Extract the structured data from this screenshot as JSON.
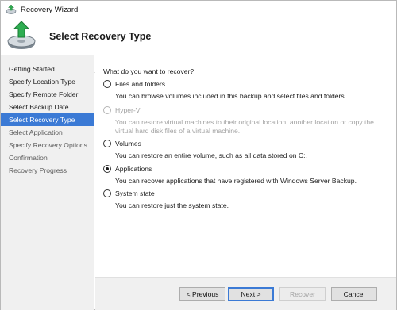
{
  "window": {
    "title": "Recovery Wizard"
  },
  "header": {
    "title": "Select Recovery Type"
  },
  "sidebar": {
    "steps": [
      {
        "label": "Getting Started",
        "state": "done"
      },
      {
        "label": "Specify Location Type",
        "state": "done"
      },
      {
        "label": "Specify Remote Folder",
        "state": "done"
      },
      {
        "label": "Select Backup Date",
        "state": "done"
      },
      {
        "label": "Select Recovery Type",
        "state": "active"
      },
      {
        "label": "Select Application",
        "state": "future"
      },
      {
        "label": "Specify Recovery Options",
        "state": "future"
      },
      {
        "label": "Confirmation",
        "state": "future"
      },
      {
        "label": "Recovery Progress",
        "state": "future"
      }
    ]
  },
  "main": {
    "question": "What do you want to recover?",
    "options": [
      {
        "label": "Files and folders",
        "description": "You can browse volumes included in this backup and select files and folders.",
        "checked": false,
        "enabled": true
      },
      {
        "label": "Hyper-V",
        "description": "You can restore virtual machines to their original location, another location or copy the virtual hard disk files of a virtual machine.",
        "checked": false,
        "enabled": false
      },
      {
        "label": "Volumes",
        "description": "You can restore an entire volume, such as all data stored on C:.",
        "checked": false,
        "enabled": true
      },
      {
        "label": "Applications",
        "description": "You can recover applications that have registered with Windows Server Backup.",
        "checked": true,
        "enabled": true
      },
      {
        "label": "System state",
        "description": "You can restore just the system state.",
        "checked": false,
        "enabled": true
      }
    ]
  },
  "footer": {
    "previous_label": "< Previous",
    "next_label": "Next >",
    "recover_label": "Recover",
    "cancel_label": "Cancel"
  },
  "colors": {
    "accent": "#3b7ad5",
    "sidebar_bg": "#f0f0f0",
    "disabled_text": "#a3a3a3"
  },
  "icons": {
    "title": "recovery-wizard-icon",
    "header": "disk-recovery-icon"
  }
}
